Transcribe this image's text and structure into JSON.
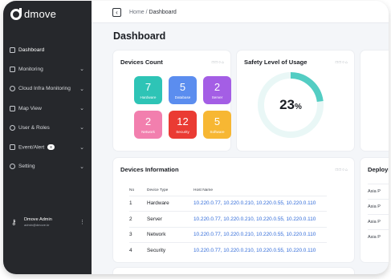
{
  "app": {
    "logo_text": "dmove"
  },
  "sidebar": {
    "items": [
      {
        "label": "Dashboard",
        "icon": "dashboard-icon",
        "active": true
      },
      {
        "label": "Monitoring",
        "icon": "chart-icon",
        "expandable": true
      },
      {
        "label": "Cloud Infra Monitoring",
        "icon": "cloud-icon",
        "expandable": true
      },
      {
        "label": "Map View",
        "icon": "map-icon",
        "expandable": true
      },
      {
        "label": "User & Roles",
        "icon": "user-icon",
        "expandable": true
      },
      {
        "label": "Event/Alert",
        "icon": "flag-icon",
        "badge": "8",
        "expandable": true
      },
      {
        "label": "Setting",
        "icon": "gear-icon",
        "expandable": true
      }
    ],
    "user": {
      "name": "Dmove Admin",
      "email": "admin@dmove.kr",
      "icon": "key-icon"
    }
  },
  "header": {
    "breadcrumb": {
      "home": "Home",
      "separator": "/",
      "current": "Dashboard"
    },
    "page_title": "Dashboard"
  },
  "devices_count": {
    "title": "Devices Count",
    "tiles": [
      {
        "value": "7",
        "label": "Hardware",
        "color": "#2ec4b6"
      },
      {
        "value": "5",
        "label": "Database",
        "color": "#5b8def"
      },
      {
        "value": "2",
        "label": "Server",
        "color": "#a45ee5"
      },
      {
        "value": "2",
        "label": "Network",
        "color": "#f27fae"
      },
      {
        "value": "12",
        "label": "Security",
        "color": "#ea3b33"
      },
      {
        "value": "5",
        "label": "Software",
        "color": "#f7b733"
      }
    ]
  },
  "safety": {
    "title": "Safety Level of Usage",
    "value": "23",
    "unit": "%",
    "fraction": 0.23,
    "color": "#53cdc3"
  },
  "devices_info": {
    "title": "Devices Information",
    "columns": [
      "No",
      "Device Type",
      "Host Name"
    ],
    "rows": [
      {
        "no": "1",
        "type": "Hardware",
        "hosts": "10.220.0.77, 10.220.0.210, 10.220.0.55, 10.220.0.110"
      },
      {
        "no": "2",
        "type": "Server",
        "hosts": "10.220.0.77, 10.220.0.210, 10.220.0.55, 10.220.0.110"
      },
      {
        "no": "3",
        "type": "Network",
        "hosts": "10.220.0.77, 10.220.0.210, 10.220.0.55, 10.220.0.110"
      },
      {
        "no": "4",
        "type": "Security",
        "hosts": "10.220.0.77, 10.220.0.210, 10.220.0.55, 10.220.0.110"
      }
    ]
  },
  "deployment": {
    "title": "Deploym",
    "rows": [
      "Asia P",
      "Asia P",
      "Asia P",
      "Asia P"
    ]
  },
  "icons": {
    "card_tools": "□□○⌂"
  }
}
